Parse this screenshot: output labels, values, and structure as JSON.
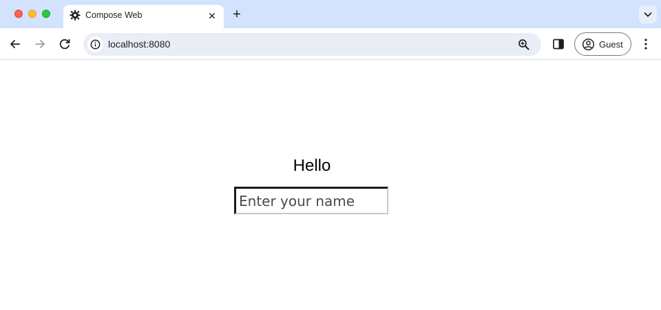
{
  "browser": {
    "tab": {
      "title": "Compose Web",
      "favicon": "gear-favicon-icon",
      "close_glyph": "✕"
    },
    "new_tab_glyph": "+",
    "toolbar": {
      "url": "localhost:8080",
      "profile_label": "Guest"
    }
  },
  "page": {
    "greeting": "Hello",
    "name_input": {
      "value": "",
      "placeholder": "Enter your name"
    }
  },
  "colors": {
    "tabstrip_bg": "#d3e3fd",
    "omnibox_bg": "#e9eef6",
    "traffic_red": "#fe5f57",
    "traffic_yellow": "#febc2e",
    "traffic_green": "#28c840"
  }
}
